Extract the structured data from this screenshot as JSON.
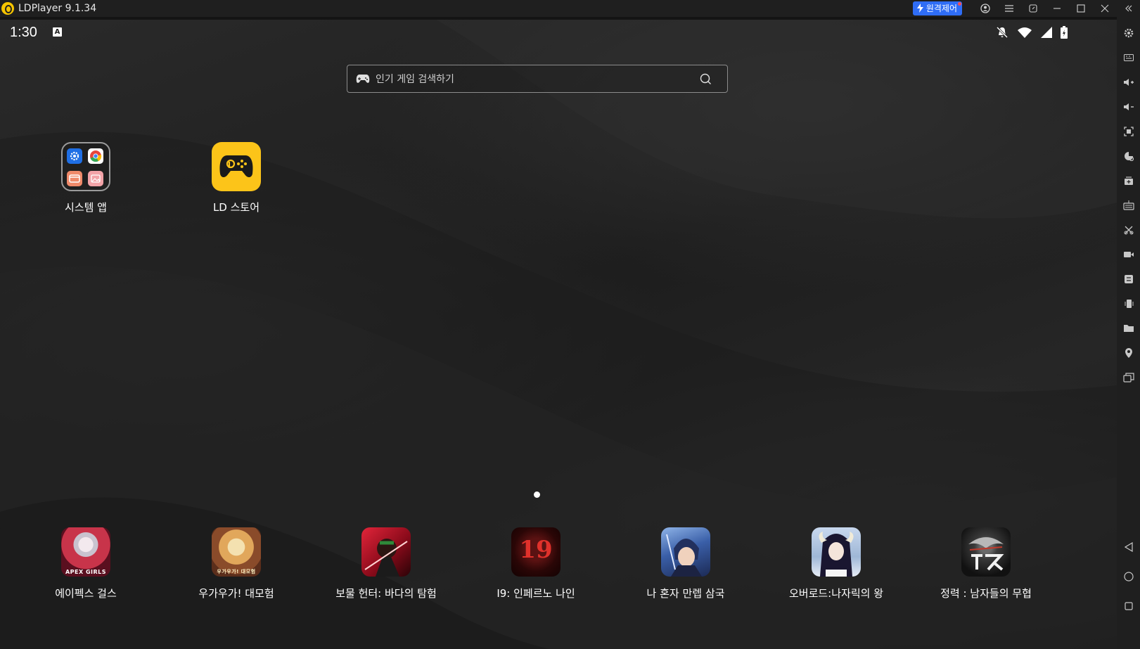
{
  "titlebar": {
    "app_title": "LDPlayer 9.1.34",
    "remote_label": "원격제어",
    "icons": [
      "account-icon",
      "menu-icon",
      "screen-sync-icon",
      "minimize-icon",
      "maximize-icon",
      "close-icon",
      "collapse-icon"
    ]
  },
  "statusbar": {
    "time": "1:30",
    "input_badge": "A",
    "icons": [
      "notifications-off-icon",
      "wifi-icon",
      "signal-icon",
      "battery-charging-icon"
    ]
  },
  "search": {
    "placeholder": "인기 게임 검색하기"
  },
  "desktop_apps": [
    {
      "label": "시스템 앱"
    },
    {
      "label": "LD 스토어"
    }
  ],
  "page_indicator": {
    "pages": 1,
    "current": 1
  },
  "dock_apps": [
    {
      "label": "에이펙스 걸스",
      "icon_text": "APEX GIRLS",
      "color": "#c8344a"
    },
    {
      "label": "우가우가! 대모험",
      "icon_text": "우가우가! 대모험",
      "color": "#d89a4a"
    },
    {
      "label": "보물 헌터: 바다의 탐험",
      "icon_text": "",
      "color": "#b0152a"
    },
    {
      "label": "I9: 인페르노 나인",
      "icon_text": "19",
      "color": "#3a0b0b"
    },
    {
      "label": "나 혼자 만렙 삼국",
      "icon_text": "",
      "color": "#3a5fa8"
    },
    {
      "label": "오버로드:나자릭의 왕",
      "icon_text": "",
      "color": "#9fb7d6"
    },
    {
      "label": "정력 : 남자들의 무협",
      "icon_text": "",
      "color": "#2b2b2b"
    }
  ],
  "sidebar_icons": [
    "settings-icon",
    "keyboard-mapping-icon",
    "volume-up-icon",
    "volume-down-icon",
    "fullscreen-icon",
    "install-apk-icon",
    "multi-instance-icon",
    "operation-recorder-icon",
    "cut-icon",
    "video-record-icon",
    "sync-icon",
    "shake-icon",
    "folder-icon",
    "location-icon",
    "more-instances-icon",
    "back-icon",
    "home-icon",
    "recents-icon"
  ]
}
